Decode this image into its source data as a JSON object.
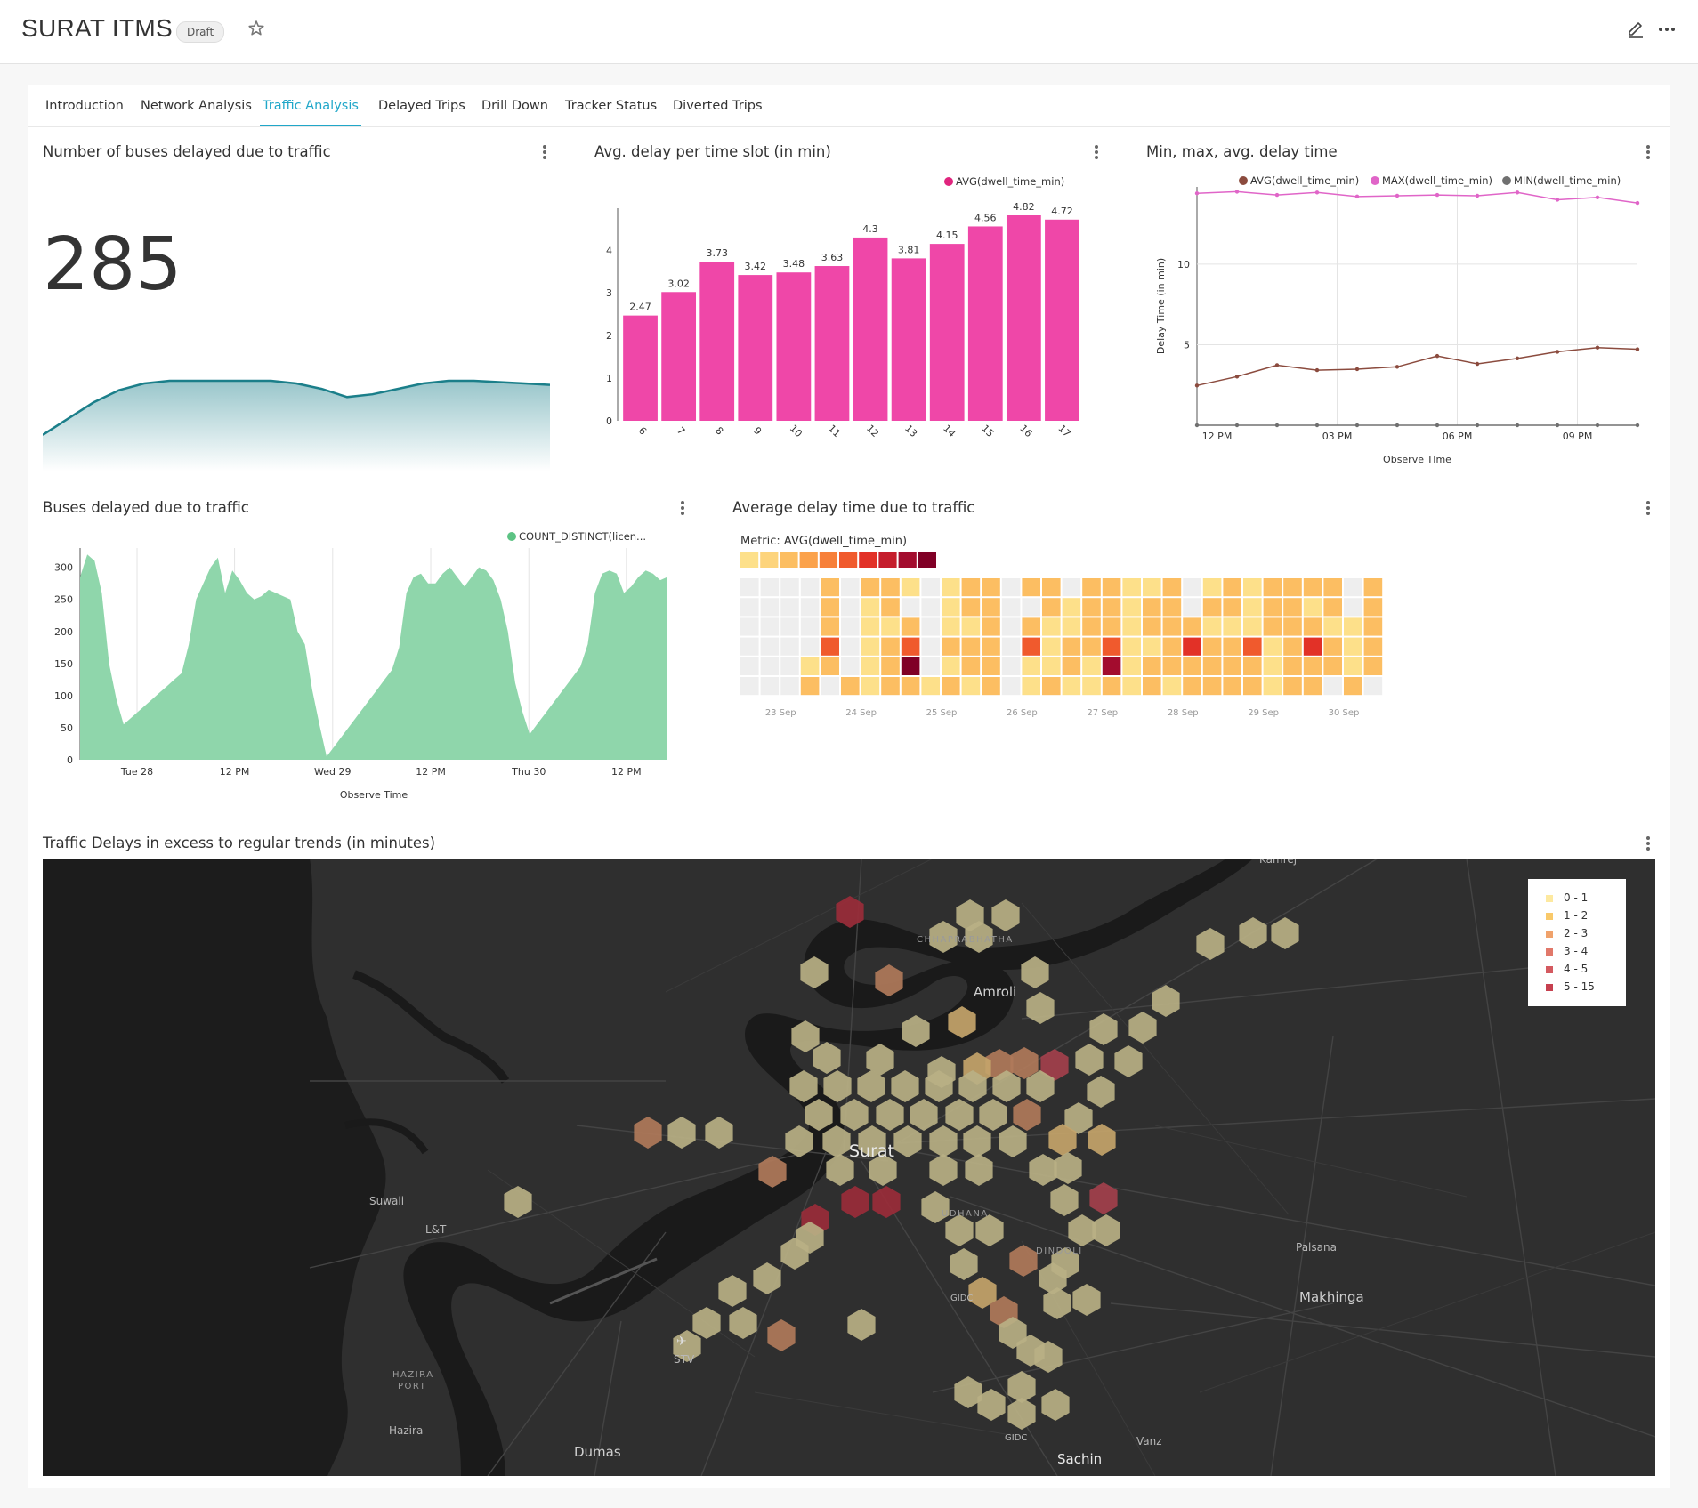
{
  "header": {
    "title": "SURAT ITMS",
    "badge": "Draft"
  },
  "tabs": [
    {
      "label": "Introduction"
    },
    {
      "label": "Network Analysis"
    },
    {
      "label": "Traffic Analysis"
    },
    {
      "label": "Delayed Trips"
    },
    {
      "label": "Drill Down"
    },
    {
      "label": "Tracker Status"
    },
    {
      "label": "Diverted Trips"
    }
  ],
  "active_tab": "Traffic Analysis",
  "panels": {
    "big_number": {
      "title": "Number of buses delayed due to traffic",
      "value": "285"
    },
    "avg_delay": {
      "title": "Avg. delay per time slot (in min)"
    },
    "min_max": {
      "title": "Min, max, avg. delay time"
    },
    "buses_delayed": {
      "title": "Buses delayed due to traffic"
    },
    "heatmap": {
      "title": "Average delay time due to traffic",
      "metric_label": "Metric: AVG(dwell_time_min)"
    },
    "map": {
      "title": "Traffic Delays in excess to regular trends (in minutes)"
    }
  },
  "colors": {
    "accent": "#20a7c9",
    "bar_pink": "#ef47a8",
    "area_green": "#8fd6ab",
    "line_teal": "#1b7f8a",
    "avg_brown": "#8b4b3e",
    "max_pink": "#e065c8",
    "min_gray": "#707070"
  },
  "chart_data": [
    {
      "type": "area",
      "title": "",
      "series": [
        {
          "values": [
            0.8,
            0.86,
            0.92,
            0.965,
            0.99,
            1.0,
            1.0,
            1.0,
            1.0,
            1.0,
            0.99,
            0.97,
            0.94,
            0.95,
            0.97,
            0.99,
            1.0,
            1.0,
            0.995,
            0.99,
            0.985
          ]
        }
      ],
      "xlabel": "",
      "ylabel": ""
    },
    {
      "type": "bar",
      "categories": [
        "6",
        "7",
        "8",
        "9",
        "10",
        "11",
        "12",
        "13",
        "14",
        "15",
        "16",
        "17"
      ],
      "series": [
        {
          "name": "AVG(dwell_time_min)",
          "values": [
            2.47,
            3.02,
            3.73,
            3.42,
            3.48,
            3.63,
            4.3,
            3.81,
            4.15,
            4.56,
            4.82,
            4.72
          ]
        }
      ],
      "data_labels": [
        "2.47",
        "3.02",
        "3.73",
        "3.42",
        "3.48",
        "3.63",
        "4.3",
        "3.81",
        "4.15",
        "4.56",
        "4.82",
        "4.72"
      ],
      "yticks": [
        "0",
        "1",
        "2",
        "3",
        "4"
      ],
      "ylim": [
        0,
        4.82
      ],
      "legend": "top-right",
      "grid": false
    },
    {
      "type": "line",
      "x": [
        11.5,
        12.5,
        13.5,
        14.5,
        15.5,
        16.5,
        17.5,
        18.5,
        19.5,
        20.5,
        21.5,
        22.5
      ],
      "xticks": [
        "12 PM",
        "03 PM",
        "06 PM",
        "09 PM"
      ],
      "xtick_values": [
        12,
        15,
        18,
        21
      ],
      "series": [
        {
          "name": "AVG(dwell_time_min)",
          "values": [
            2.47,
            3.02,
            3.73,
            3.42,
            3.48,
            3.63,
            4.3,
            3.81,
            4.15,
            4.56,
            4.82,
            4.72
          ]
        },
        {
          "name": "MAX(dwell_time_min)",
          "values": [
            14.4,
            14.5,
            14.3,
            14.45,
            14.2,
            14.25,
            14.3,
            14.25,
            14.45,
            14.0,
            14.15,
            13.8
          ]
        },
        {
          "name": "MIN(dwell_time_min)",
          "values": [
            0,
            0,
            0,
            0,
            0,
            0,
            0,
            0,
            0,
            0,
            0,
            0
          ]
        }
      ],
      "yticks": [
        "5",
        "10"
      ],
      "ytick_values": [
        5,
        10
      ],
      "ylim": [
        0,
        14.8
      ],
      "xlim": [
        11.5,
        22.5
      ],
      "xlabel": "Observe TIme",
      "ylabel": "Delay Time (in min)",
      "legend": "top",
      "grid": true
    },
    {
      "type": "area",
      "series": [
        {
          "name": "COUNT_DISTINCT(licen...",
          "values": [
            285,
            320,
            310,
            260,
            150,
            95,
            55,
            65,
            75,
            85,
            95,
            105,
            115,
            125,
            135,
            180,
            250,
            275,
            300,
            315,
            260,
            295,
            280,
            260,
            250,
            255,
            265,
            260,
            255,
            250,
            200,
            180,
            110,
            55,
            5,
            20,
            35,
            50,
            65,
            80,
            95,
            110,
            125,
            140,
            175,
            260,
            285,
            290,
            275,
            275,
            290,
            300,
            285,
            270,
            285,
            300,
            295,
            280,
            250,
            200,
            120,
            75,
            40,
            55,
            70,
            85,
            100,
            115,
            130,
            145,
            180,
            260,
            290,
            295,
            290,
            260,
            270,
            285,
            295,
            290,
            280,
            285
          ]
        }
      ],
      "xticks": [
        "Tue 28",
        "12 PM",
        "Wed 29",
        "12 PM",
        "Thu 30",
        "12 PM"
      ],
      "xtick_positions": [
        0.097,
        0.263,
        0.43,
        0.597,
        0.764,
        0.93
      ],
      "yticks": [
        "0",
        "50",
        "100",
        "150",
        "200",
        "250",
        "300"
      ],
      "ylim": [
        0,
        330
      ],
      "xlabel": "Observe Time",
      "legend": "top-right",
      "grid": true
    },
    {
      "type": "heatmap",
      "title": "Metric: AVG(dwell_time_min)",
      "xticks": [
        "23 Sep",
        "24 Sep",
        "25 Sep",
        "26 Sep",
        "27 Sep",
        "28 Sep",
        "29 Sep",
        "30 Sep"
      ],
      "columns": 32,
      "rows": 6,
      "scale_colors": [
        "#fde08a",
        "#fdd47c",
        "#fcbe62",
        "#fba24b",
        "#f7803a",
        "#f05a2d",
        "#e23127",
        "#c51d2c",
        "#a30c2e",
        "#800026"
      ],
      "cells": [
        "eeeeeeeee3eeeeeeeeeeeee",
        "...."
      ]
    }
  ],
  "heatmap_grid": [
    [
      0,
      0,
      0,
      0,
      2,
      0,
      2,
      2,
      1,
      0,
      1,
      2,
      2,
      0,
      2,
      2,
      0,
      2,
      2,
      1,
      1,
      2,
      0,
      1,
      2,
      1,
      2,
      2,
      2,
      2,
      0,
      2
    ],
    [
      0,
      0,
      0,
      0,
      2,
      0,
      1,
      2,
      0,
      0,
      1,
      2,
      2,
      0,
      0,
      2,
      1,
      2,
      2,
      1,
      2,
      2,
      0,
      2,
      2,
      1,
      2,
      2,
      1,
      2,
      0,
      2
    ],
    [
      0,
      0,
      0,
      0,
      2,
      0,
      1,
      1,
      2,
      0,
      1,
      1,
      2,
      0,
      2,
      1,
      1,
      2,
      2,
      1,
      2,
      2,
      2,
      1,
      1,
      1,
      2,
      2,
      2,
      1,
      1,
      2
    ],
    [
      0,
      0,
      0,
      0,
      5,
      0,
      1,
      2,
      5,
      0,
      2,
      2,
      2,
      0,
      5,
      1,
      2,
      2,
      5,
      1,
      1,
      2,
      6,
      2,
      2,
      5,
      1,
      2,
      6,
      2,
      1,
      2
    ],
    [
      0,
      0,
      0,
      1,
      2,
      0,
      1,
      2,
      9,
      0,
      1,
      2,
      2,
      0,
      1,
      1,
      2,
      1,
      8,
      1,
      2,
      2,
      2,
      2,
      2,
      2,
      1,
      2,
      2,
      2,
      1,
      2
    ],
    [
      0,
      0,
      0,
      2,
      0,
      2,
      1,
      2,
      2,
      1,
      2,
      1,
      2,
      0,
      1,
      2,
      1,
      1,
      2,
      1,
      2,
      1,
      2,
      2,
      2,
      2,
      1,
      2,
      2,
      0,
      2,
      0
    ]
  ],
  "map": {
    "labels": {
      "kamrej": "Kamrej",
      "chhaprabhatha": "CHHAPRABHATHA",
      "amroli": "Amroli",
      "surat": "Surat",
      "suwali": "Suwali",
      "lt": "L&T",
      "udhana": "UDHANA",
      "dindoli": "DINDOLI",
      "palsana": "Palsana",
      "makhinga": "Makhinga",
      "gidc1": "GIDC",
      "stv": "STV",
      "hazira_port_1": "HAZIRA",
      "hazira_port_2": "PORT",
      "hazira": "Hazira",
      "dumas": "Dumas",
      "gidc2": "GIDC",
      "vanz": "Vanz",
      "sachin": "Sachin"
    },
    "legend": [
      {
        "label": "0 - 1",
        "color": "#fde9a0"
      },
      {
        "label": "1 - 2",
        "color": "#f9c96a"
      },
      {
        "label": "2 - 3",
        "color": "#f0a26b"
      },
      {
        "label": "3 - 4",
        "color": "#e1786a"
      },
      {
        "label": "4 - 5",
        "color": "#d45a60"
      },
      {
        "label": "5 - 15",
        "color": "#c6404f"
      }
    ]
  }
}
